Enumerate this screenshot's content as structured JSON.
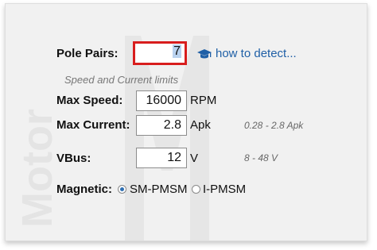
{
  "watermark": {
    "text": "Motor"
  },
  "pole_pairs": {
    "label": "Pole Pairs:",
    "value": "7",
    "help_link": "how to detect...",
    "help_icon": "graduation-cap-icon"
  },
  "section_heading": "Speed and Current limits",
  "max_speed": {
    "label": "Max Speed:",
    "value": "16000",
    "unit": "RPM"
  },
  "max_current": {
    "label": "Max Current:",
    "value": "2.8",
    "unit": "Apk",
    "range": "0.28 - 2.8 Apk"
  },
  "vbus": {
    "label": "VBus:",
    "value": "12",
    "unit": "V",
    "range": "8 - 48 V"
  },
  "magnetic": {
    "label": "Magnetic:",
    "options": [
      {
        "label": "SM-PMSM",
        "selected": true
      },
      {
        "label": "I-PMSM",
        "selected": false
      }
    ]
  },
  "colors": {
    "accent": "#1f5fa6",
    "focus_border": "#d81d1d",
    "panel_bg": "#f1f1f1"
  }
}
